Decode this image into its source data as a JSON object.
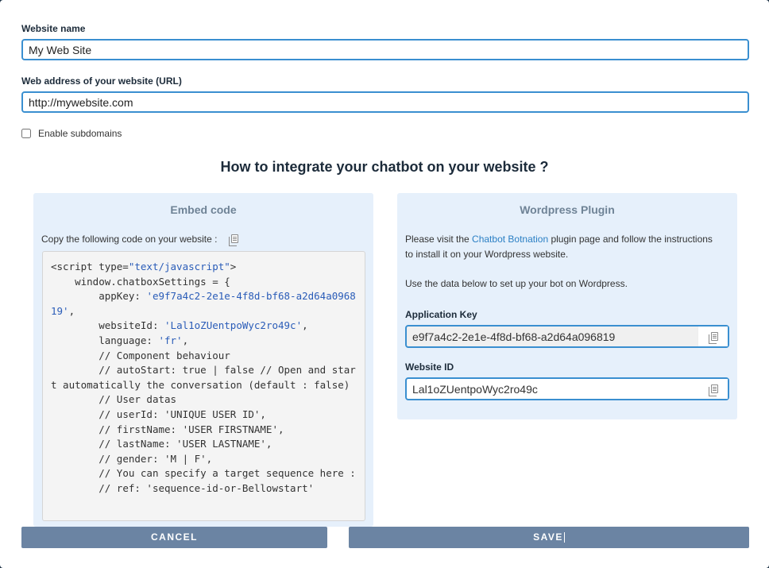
{
  "form": {
    "website_name_label": "Website name",
    "website_name_value": "My Web Site",
    "url_label": "Web address of your website (URL)",
    "url_value": "http://mywebsite.com",
    "subdomains_label": "Enable subdomains",
    "subdomains_checked": false
  },
  "integration": {
    "title": "How to integrate your chatbot on your website ?"
  },
  "embed": {
    "title": "Embed code",
    "instruction": "Copy the following code on your website :",
    "code_lines": [
      {
        "pre": "<script type=",
        "str": "\"text/javascript\"",
        "post": ">"
      },
      {
        "pre": "    window.chatboxSettings = {",
        "str": "",
        "post": ""
      },
      {
        "pre": "        appKey: ",
        "str": "'e9f7a4c2-2e1e-4f8d-bf68-a2d64a096819'",
        "post": ","
      },
      {
        "pre": "        websiteId: ",
        "str": "'Lal1oZUentpoWyc2ro49c'",
        "post": ","
      },
      {
        "pre": "        language: ",
        "str": "'fr'",
        "post": ","
      },
      {
        "pre": "        // Component behaviour",
        "str": "",
        "post": ""
      },
      {
        "pre": "        // autoStart: true | false // Open and start automatically the conversation (default : false)",
        "str": "",
        "post": ""
      },
      {
        "pre": "        // User datas",
        "str": "",
        "post": ""
      },
      {
        "pre": "        // userId: 'UNIQUE USER ID',",
        "str": "",
        "post": ""
      },
      {
        "pre": "        // firstName: 'USER FIRSTNAME',",
        "str": "",
        "post": ""
      },
      {
        "pre": "        // lastName: 'USER LASTNAME',",
        "str": "",
        "post": ""
      },
      {
        "pre": "        // gender: 'M | F',",
        "str": "",
        "post": ""
      },
      {
        "pre": "        // You can specify a target sequence here :",
        "str": "",
        "post": ""
      },
      {
        "pre": "        // ref: 'sequence-id-or-Bellowstart'",
        "str": "",
        "post": ""
      }
    ]
  },
  "wordpress": {
    "title": "Wordpress Plugin",
    "visit_pre": "Please visit the ",
    "visit_link": "Chatbot Botnation",
    "visit_post": " plugin page and follow the instructions to install it on your Wordpress website.",
    "use_data": "Use the data below to set up your bot on Wordpress.",
    "app_key_label": "Application Key",
    "app_key_value": "e9f7a4c2-2e1e-4f8d-bf68-a2d64a096819",
    "website_id_label": "Website ID",
    "website_id_value": "Lal1oZUentpoWyc2ro49c"
  },
  "actions": {
    "cancel_label": "CANCEL",
    "save_label": "SAVE"
  },
  "icons": {
    "copy": "copy-icon"
  },
  "colors": {
    "accent": "#3a8fd0",
    "button": "#6b84a3",
    "panel": "#e6f0fb"
  }
}
